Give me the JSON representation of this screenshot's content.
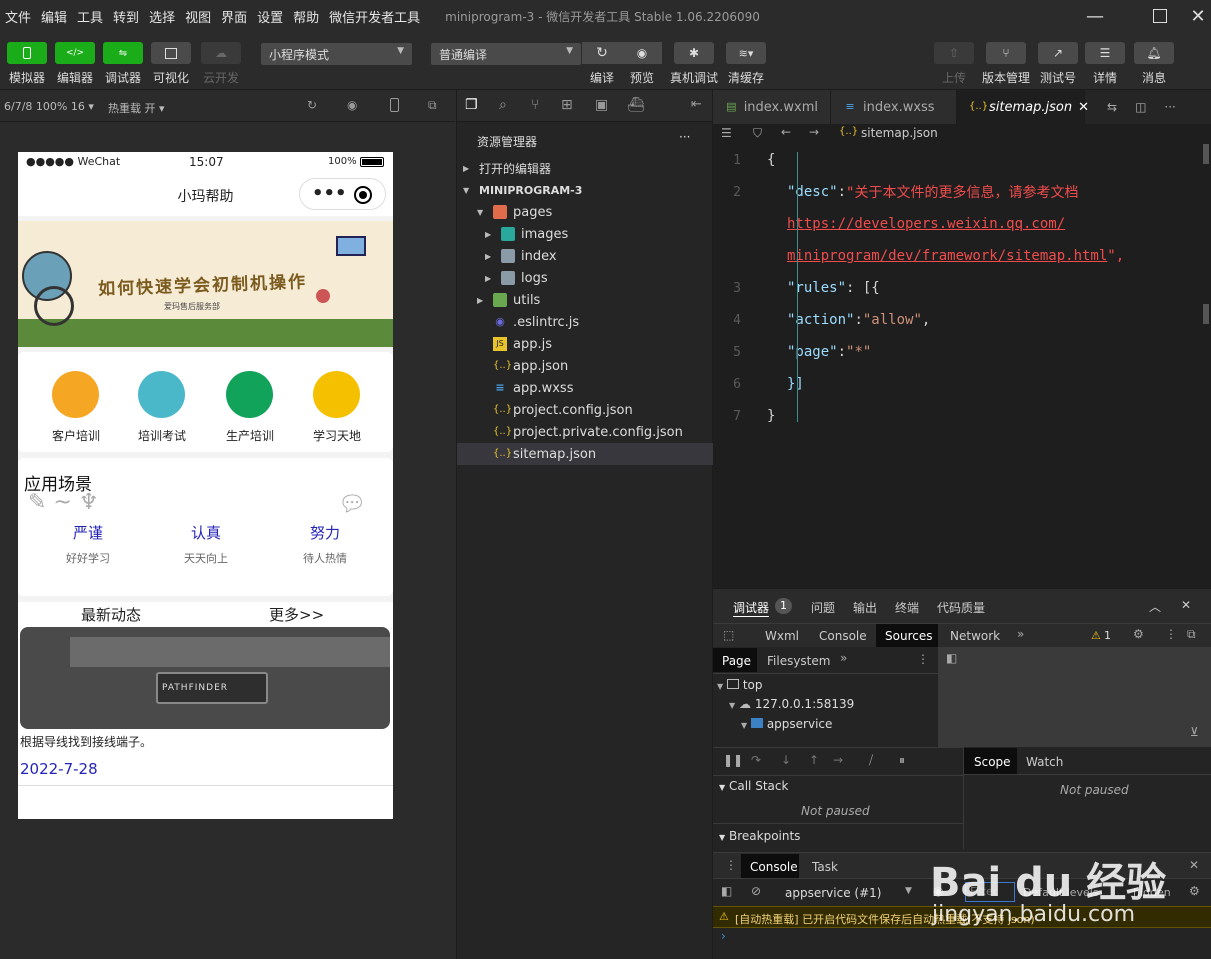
{
  "menu": [
    "文件",
    "编辑",
    "工具",
    "转到",
    "选择",
    "视图",
    "界面",
    "设置",
    "帮助",
    "微信开发者工具"
  ],
  "window_title": "miniprogram-3 - 微信开发者工具 Stable 1.06.2206090",
  "toolbar": {
    "simulator": "模拟器",
    "editor": "编辑器",
    "debugger": "调试器",
    "visual": "可视化",
    "cloud": "云开发",
    "mode": "小程序模式",
    "compile_mode": "普通编译",
    "compile": "编译",
    "preview": "预览",
    "real_debug": "真机调试",
    "clear_cache": "清缓存",
    "upload": "上传",
    "version": "版本管理",
    "test_id": "测试号",
    "details": "详情",
    "messages": "消息"
  },
  "sim": {
    "device": "6/7/8 100% 16",
    "hot_reload": "热重载 开"
  },
  "phone": {
    "status_carrier": "●●●●● WeChat",
    "status_time": "15:07",
    "status_battery": "100%",
    "nav_title": "小玛帮助",
    "capsule_dots": "•••",
    "banner_title": "如何快速学会初制机操作",
    "banner_sub": "爱玛售后服务部",
    "grid": [
      {
        "label": "客户培训",
        "color": "#f5a623"
      },
      {
        "label": "培训考试",
        "color": "#4ab8c9"
      },
      {
        "label": "生产培训",
        "color": "#12a35a"
      },
      {
        "label": "学习天地",
        "color": "#f5c000"
      }
    ],
    "section_title": "应用场景",
    "scenes": [
      {
        "title": "严谨",
        "sub": "好好学习"
      },
      {
        "title": "认真",
        "sub": "天天向上"
      },
      {
        "title": "努力",
        "sub": "待人热情"
      }
    ],
    "news_label": "最新动态",
    "more_label": "更多>>",
    "news_image_text": "PATHFINDER",
    "news_caption": "根据导线找到接线端子。",
    "news_date": "2022-7-28"
  },
  "explorer": {
    "title": "资源管理器",
    "more": "···",
    "open_editors": "打开的编辑器",
    "project": "MINIPROGRAM-3",
    "items": [
      {
        "label": "pages",
        "icon": "folder-red"
      },
      {
        "label": "images",
        "icon": "folder-teal"
      },
      {
        "label": "index",
        "icon": "folder-gray"
      },
      {
        "label": "logs",
        "icon": "folder-gray"
      },
      {
        "label": "utils",
        "icon": "folder-green"
      },
      {
        "label": ".eslintrc.js",
        "icon": "eslint"
      },
      {
        "label": "app.js",
        "icon": "js"
      },
      {
        "label": "app.json",
        "icon": "json"
      },
      {
        "label": "app.wxss",
        "icon": "wxss"
      },
      {
        "label": "project.config.json",
        "icon": "json"
      },
      {
        "label": "project.private.config.json",
        "icon": "json"
      },
      {
        "label": "sitemap.json",
        "icon": "json"
      }
    ]
  },
  "editor": {
    "tabs": [
      "index.wxml",
      "index.wxss",
      "sitemap.json"
    ],
    "breadcrumb": "sitemap.json",
    "code": {
      "l1": "{",
      "desc_key": "\"desc\"",
      "desc_val1": "\"关于本文件的更多信息，请参考文档",
      "url1": "https://developers.weixin.qq.com/",
      "url2": "miniprogram/dev/framework/sitemap.html",
      "desc_end": "\",",
      "rules_key": "\"rules\"",
      "rules_open": ": [{",
      "action_key": "\"action\"",
      "action_val": "\"allow\"",
      "page_key": "\"page\"",
      "page_val": "\"*\"",
      "close_arr": "}]",
      "close_obj": "}"
    },
    "line_numbers": [
      "1",
      "2",
      "3",
      "4",
      "5",
      "6",
      "7"
    ]
  },
  "debug": {
    "top_tabs": [
      "调试器",
      "问题",
      "输出",
      "终端",
      "代码质量"
    ],
    "badge": "1",
    "dev_tabs": [
      "Wxml",
      "Console",
      "Sources",
      "Network"
    ],
    "warn_count": "1",
    "sources_tabs": [
      "Page",
      "Filesystem"
    ],
    "tree": [
      "top",
      "127.0.0.1:58139",
      "appservice"
    ],
    "scope_tabs": [
      "Scope",
      "Watch"
    ],
    "not_paused": "Not paused",
    "call_stack": "Call Stack",
    "breakpoints": "Breakpoints",
    "console_tabs": [
      "Console",
      "Task"
    ],
    "context": "appservice (#1)",
    "filter_ph": "Filter",
    "levels": "Default levels",
    "hidden": "hidden",
    "warning_msg": "[自动热重载] 已开启代码文件保存后自动热重载(不支持 json)"
  },
  "watermark": {
    "brand": "Bai du 经验",
    "url": "jingyan.baidu.com"
  }
}
